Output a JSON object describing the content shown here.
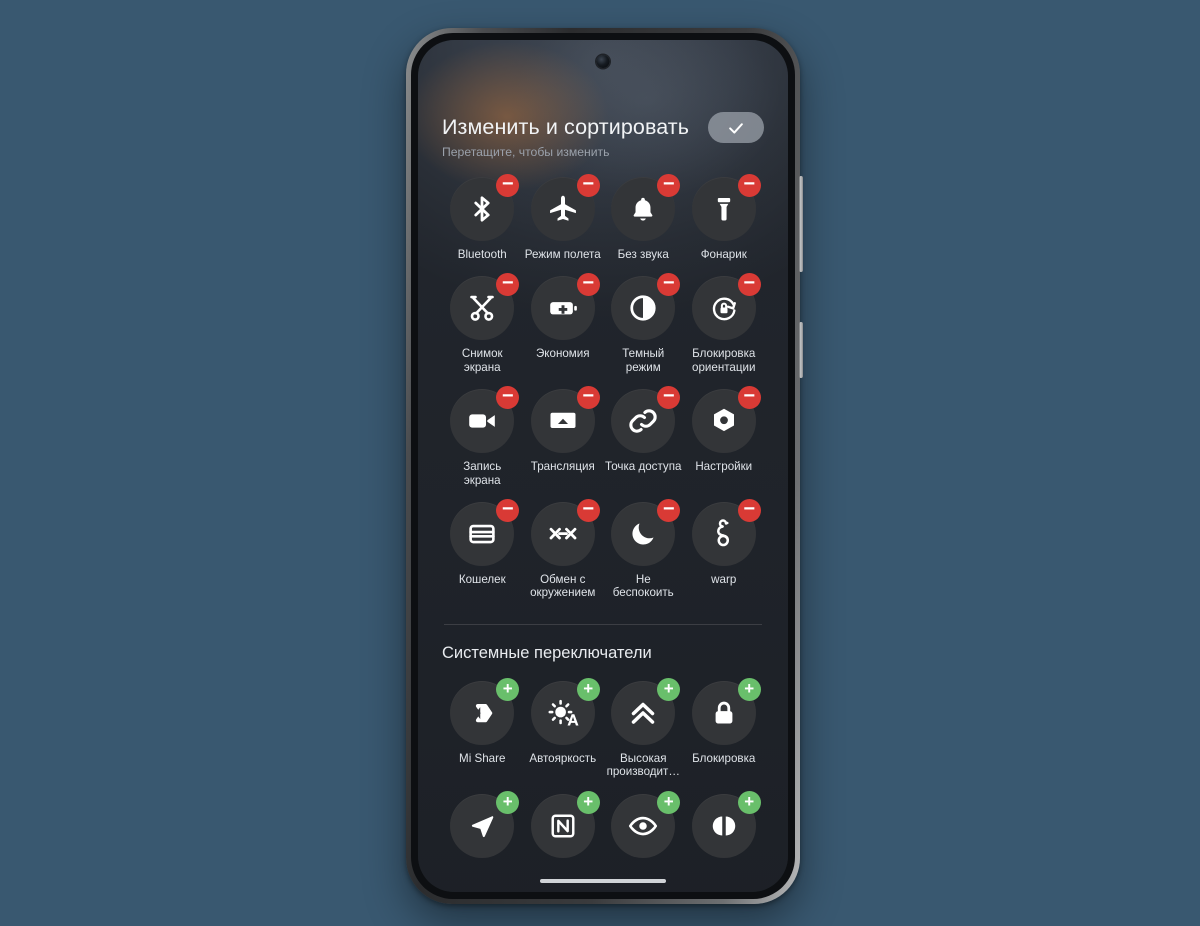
{
  "background_color": "#395870",
  "screen": {
    "header": {
      "title": "Изменить и сортировать",
      "subtitle": "Перетащите, чтобы изменить",
      "confirm_icon": "check-icon"
    },
    "active_tiles": [
      {
        "label": "Bluetooth",
        "icon": "bluetooth-icon",
        "badge": "remove"
      },
      {
        "label": "Режим полета",
        "icon": "airplane-icon",
        "badge": "remove"
      },
      {
        "label": "Без звука",
        "icon": "bell-icon",
        "badge": "remove"
      },
      {
        "label": "Фонарик",
        "icon": "flashlight-icon",
        "badge": "remove"
      },
      {
        "label": "Снимок\nэкрана",
        "icon": "scissors-icon",
        "badge": "remove"
      },
      {
        "label": "Экономия",
        "icon": "battery-saver-icon",
        "badge": "remove"
      },
      {
        "label": "Темный\nрежим",
        "icon": "contrast-icon",
        "badge": "remove"
      },
      {
        "label": "Блокировка\nориентации",
        "icon": "rotation-lock-icon",
        "badge": "remove"
      },
      {
        "label": "Запись\nэкрана",
        "icon": "camcorder-icon",
        "badge": "remove"
      },
      {
        "label": "Трансляция",
        "icon": "cast-icon",
        "badge": "remove"
      },
      {
        "label": "Точка доступа",
        "icon": "link-icon",
        "badge": "remove"
      },
      {
        "label": "Настройки",
        "icon": "settings-hex-icon",
        "badge": "remove"
      },
      {
        "label": "Кошелек",
        "icon": "wallet-card-icon",
        "badge": "remove"
      },
      {
        "label": "Обмен с\nокружением",
        "icon": "nearby-share-icon",
        "badge": "remove"
      },
      {
        "label": "Не\nбеспокоить",
        "icon": "moon-icon",
        "badge": "remove"
      },
      {
        "label": "warp",
        "icon": "warp-worm-icon",
        "badge": "remove"
      }
    ],
    "system_section": {
      "title": "Системные переключатели",
      "tiles": [
        {
          "label": "Mi Share",
          "icon": "mi-share-icon",
          "badge": "add"
        },
        {
          "label": "Автояркость",
          "icon": "auto-brightness-icon",
          "badge": "add"
        },
        {
          "label": "Высокая\nпроизводит…",
          "icon": "double-chevron-up-icon",
          "badge": "add"
        },
        {
          "label": "Блокировка",
          "icon": "padlock-icon",
          "badge": "add"
        },
        {
          "label": "",
          "icon": "location-arrow-icon",
          "badge": "add"
        },
        {
          "label": "",
          "icon": "nfc-icon",
          "badge": "add"
        },
        {
          "label": "",
          "icon": "eye-icon",
          "badge": "add"
        },
        {
          "label": "",
          "icon": "dolby-icon",
          "badge": "add"
        }
      ]
    },
    "badge_labels": {
      "remove": "−",
      "add": "+"
    },
    "colors": {
      "badge_remove": "#d93a35",
      "badge_add": "#69bf6b",
      "tile_circle": "#333538",
      "confirm_pill": "#969ca5"
    }
  }
}
